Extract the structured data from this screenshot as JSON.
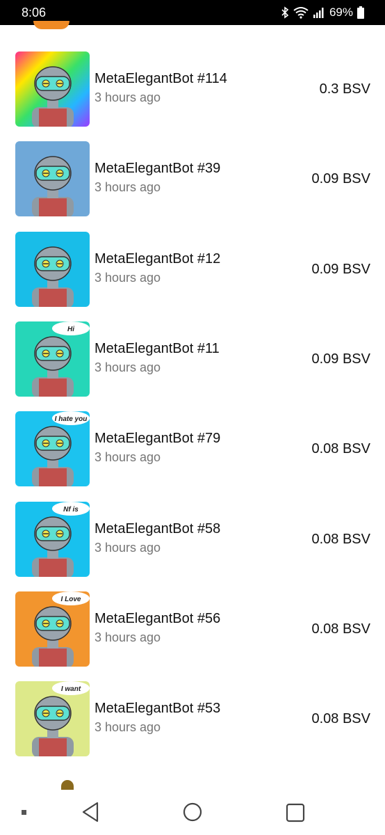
{
  "status_bar": {
    "time": "8:06",
    "battery": "69%"
  },
  "items": [
    {
      "title": "MetaElegantBot #114",
      "time": "3 hours ago",
      "price": "0.3 BSV",
      "bg": "rainbow",
      "bubble": ""
    },
    {
      "title": "MetaElegantBot #39",
      "time": "3 hours ago",
      "price": "0.09 BSV",
      "bg": "#6fa8d8",
      "bubble": ""
    },
    {
      "title": "MetaElegantBot #12",
      "time": "3 hours ago",
      "price": "0.09 BSV",
      "bg": "#19bde8",
      "bubble": ""
    },
    {
      "title": "MetaElegantBot #11",
      "time": "3 hours ago",
      "price": "0.09 BSV",
      "bg": "#26d6b8",
      "bubble": "Hi"
    },
    {
      "title": "MetaElegantBot #79",
      "time": "3 hours ago",
      "price": "0.08 BSV",
      "bg": "#1cc3ef",
      "bubble": "I hate you"
    },
    {
      "title": "MetaElegantBot #58",
      "time": "3 hours ago",
      "price": "0.08 BSV",
      "bg": "#18c1ee",
      "bubble": "Nf is"
    },
    {
      "title": "MetaElegantBot #56",
      "time": "3 hours ago",
      "price": "0.08 BSV",
      "bg": "#f2952e",
      "bubble": "I Love"
    },
    {
      "title": "MetaElegantBot #53",
      "time": "3 hours ago",
      "price": "0.08 BSV",
      "bg": "#dde98a",
      "bubble": "I want"
    }
  ]
}
